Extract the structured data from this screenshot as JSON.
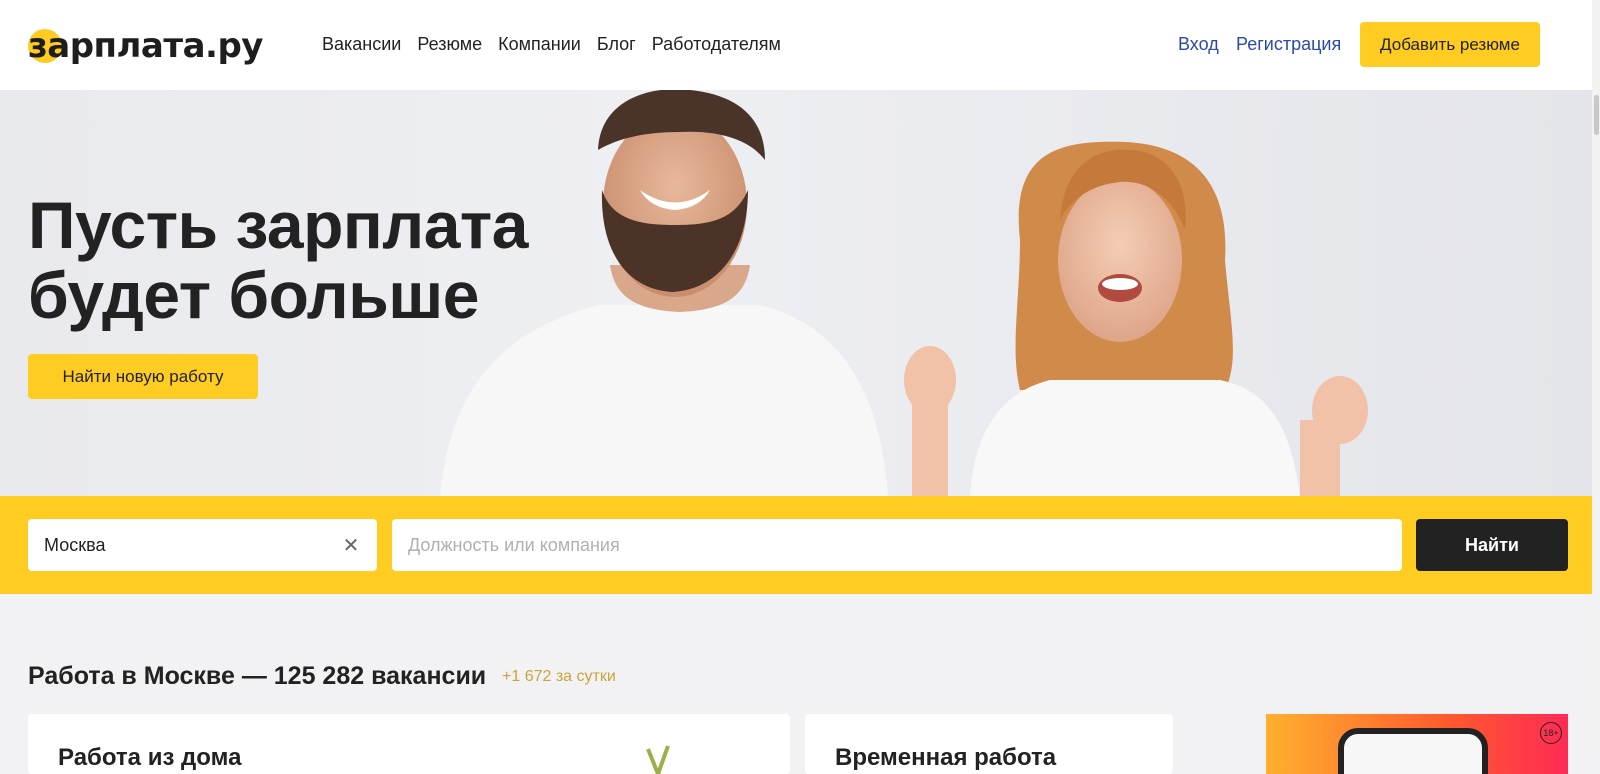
{
  "header": {
    "logo_text": "зарплата.ру",
    "nav": [
      "Вакансии",
      "Резюме",
      "Компании",
      "Блог",
      "Работодателям"
    ],
    "login": "Вход",
    "register": "Регистрация",
    "add_resume": "Добавить резюме"
  },
  "hero": {
    "title_line1": "Пусть зарплата",
    "title_line2": "будет больше",
    "cta": "Найти новую работу"
  },
  "search": {
    "city_value": "Москва",
    "job_placeholder": "Должность или компания",
    "submit": "Найти"
  },
  "section": {
    "title": "Работа в Москве — 125 282 вакансии",
    "delta": "+1 672 за сутки"
  },
  "cards": [
    {
      "title": "Работа из дома"
    },
    {
      "title": "Временная работа"
    }
  ],
  "promo": {
    "age_badge": "18+"
  },
  "colors": {
    "accent": "#ffcc22",
    "link": "#2b49a8",
    "dark_button": "#222222",
    "delta": "#c9a43a"
  }
}
